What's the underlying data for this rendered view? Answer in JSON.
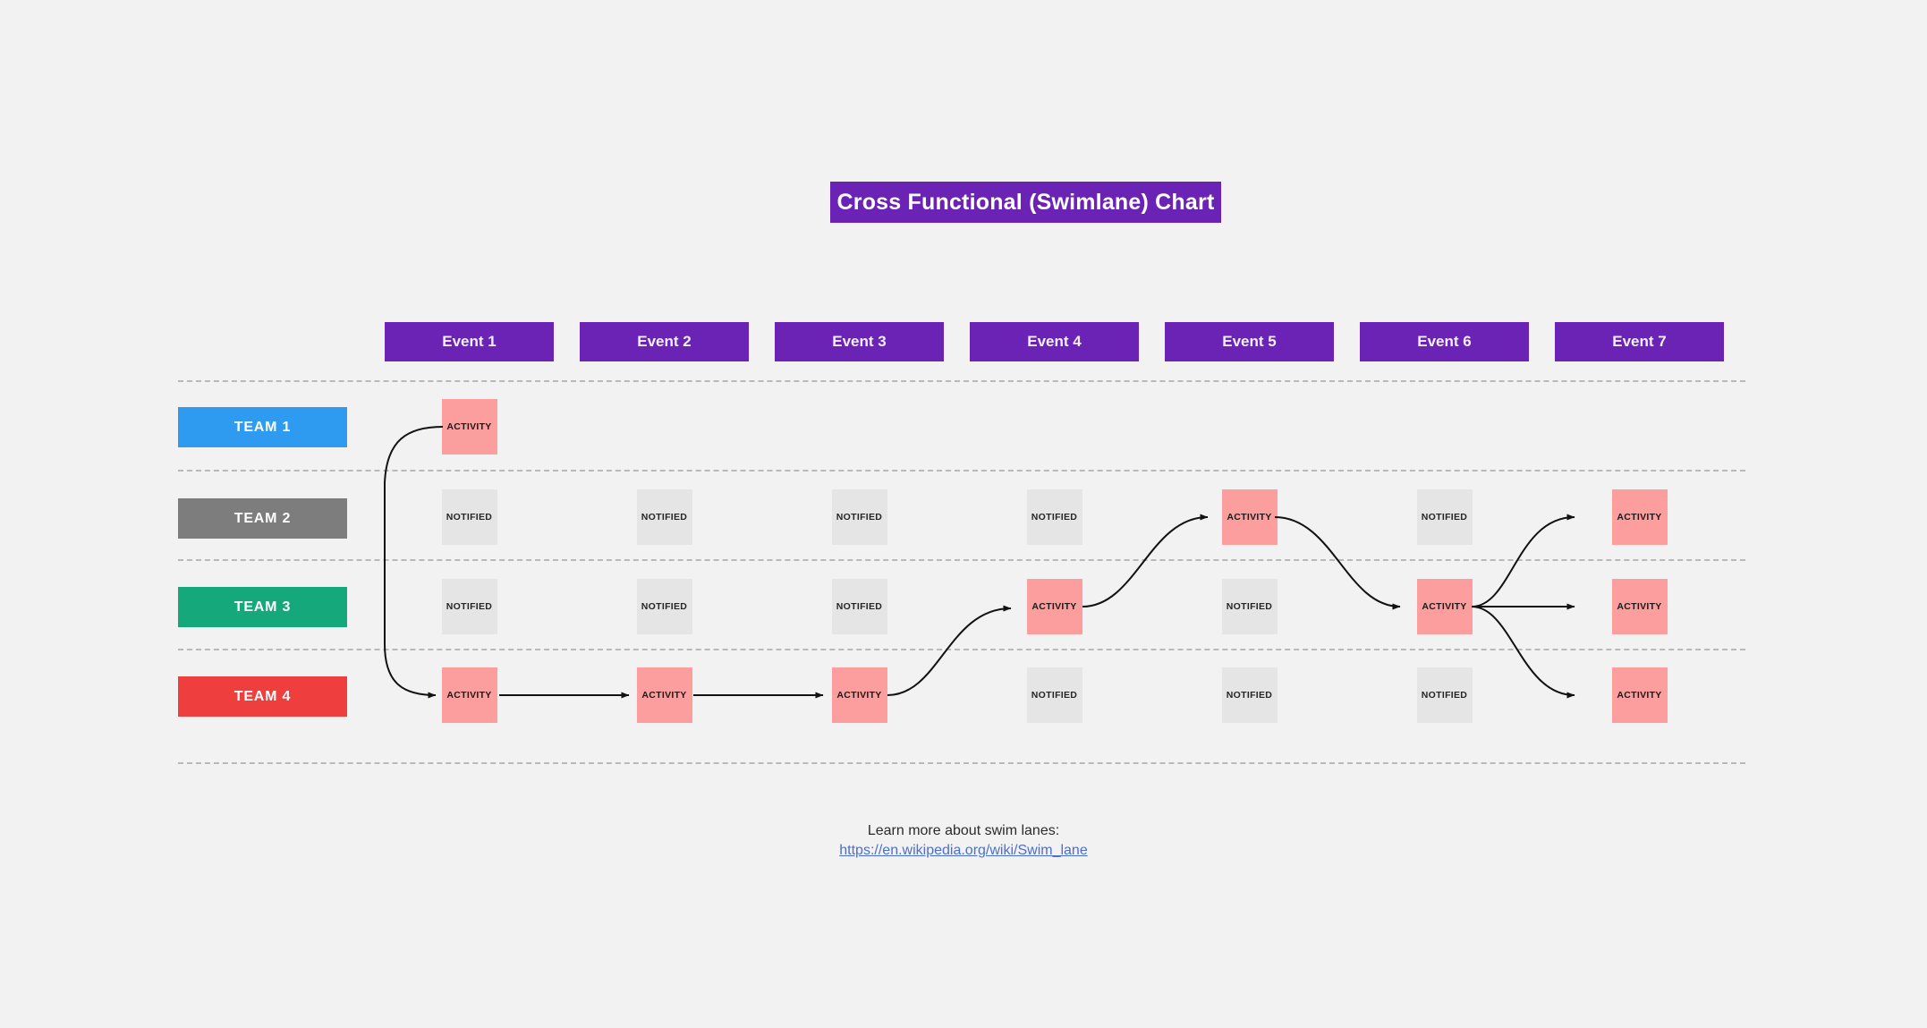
{
  "title": "Cross Functional (Swimlane) Chart",
  "events": [
    {
      "label": "Event 1"
    },
    {
      "label": "Event 2"
    },
    {
      "label": "Event 3"
    },
    {
      "label": "Event 4"
    },
    {
      "label": "Event 5"
    },
    {
      "label": "Event 6"
    },
    {
      "label": "Event 7"
    }
  ],
  "teams": [
    {
      "label": "TEAM 1",
      "color": "#2e9bf0"
    },
    {
      "label": "TEAM 2",
      "color": "#7d7d7d"
    },
    {
      "label": "TEAM 3",
      "color": "#14a87a"
    },
    {
      "label": "TEAM 4",
      "color": "#ef3e3e"
    }
  ],
  "cell_labels": {
    "activity": "ACTIVITY",
    "notified": "NOTIFIED"
  },
  "grid": [
    {
      "team": "TEAM 1",
      "cells": [
        "ACTIVITY",
        "",
        "",
        "",
        "",
        "",
        ""
      ]
    },
    {
      "team": "TEAM 2",
      "cells": [
        "NOTIFIED",
        "NOTIFIED",
        "NOTIFIED",
        "NOTIFIED",
        "ACTIVITY",
        "NOTIFIED",
        "ACTIVITY"
      ]
    },
    {
      "team": "TEAM 3",
      "cells": [
        "NOTIFIED",
        "NOTIFIED",
        "NOTIFIED",
        "ACTIVITY",
        "NOTIFIED",
        "ACTIVITY",
        "ACTIVITY"
      ]
    },
    {
      "team": "TEAM 4",
      "cells": [
        "ACTIVITY",
        "ACTIVITY",
        "ACTIVITY",
        "NOTIFIED",
        "NOTIFIED",
        "NOTIFIED",
        "ACTIVITY"
      ]
    }
  ],
  "footer": {
    "text": "Learn more about swim lanes:",
    "link": "https://en.wikipedia.org/wiki/Swim_lane"
  },
  "colors": {
    "background": "#f2f2f2",
    "header_purple": "#6a23b5",
    "activity": "#fd9e9e",
    "notified": "#e5e5e5",
    "divider": "#b9b9b9",
    "connector": "#121212",
    "link": "#4a6fd4"
  }
}
